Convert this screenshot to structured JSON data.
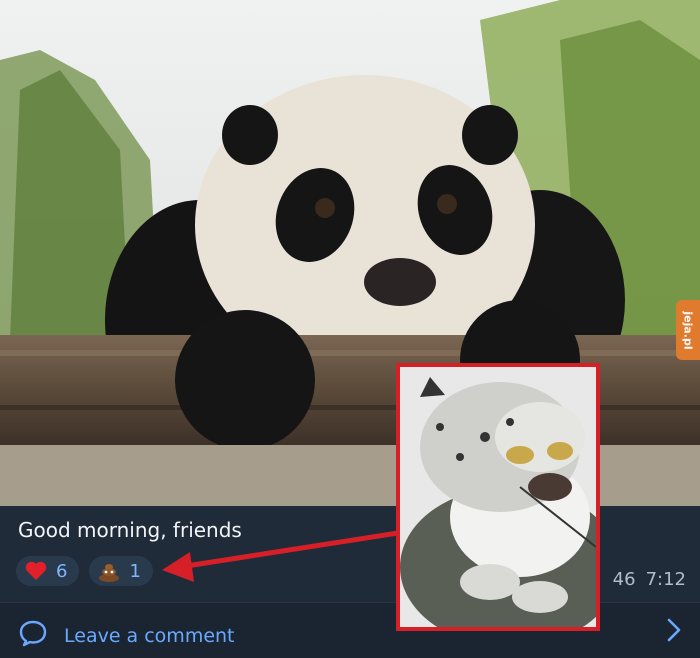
{
  "post": {
    "caption": "Good morning, friends",
    "reactions": [
      {
        "emoji": "heart",
        "count": "6"
      },
      {
        "emoji": "pile-of-poo",
        "count": "1"
      }
    ],
    "views": "46",
    "time": "7:12"
  },
  "footer": {
    "comment_label": "Leave a comment"
  },
  "watermark": {
    "text": "jeja.pl"
  },
  "colors": {
    "accent": "#6aa9ff",
    "callout": "#d71f27",
    "background": "#1f2b38"
  }
}
